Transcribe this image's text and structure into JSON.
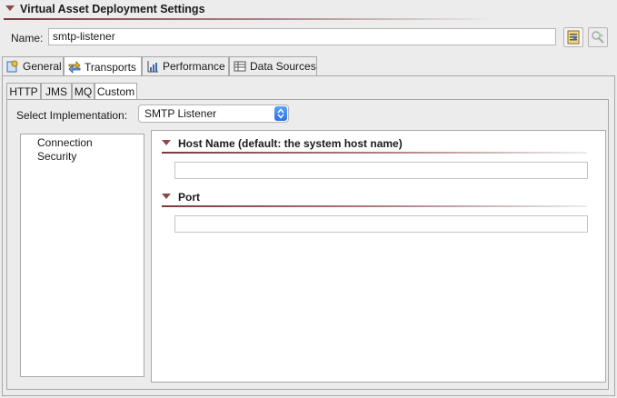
{
  "section": {
    "title": "Virtual Asset Deployment Settings"
  },
  "name_field": {
    "label": "Name:",
    "value": "smtp-listener"
  },
  "toolbar": {
    "btn1_icon": "import-icon",
    "btn2_icon": "find-icon"
  },
  "main_tabs": [
    {
      "label": "General",
      "icon": "general-icon"
    },
    {
      "label": "Transports",
      "icon": "transports-icon"
    },
    {
      "label": "Performance",
      "icon": "performance-icon"
    },
    {
      "label": "Data Sources",
      "icon": "data-sources-icon"
    }
  ],
  "sub_tabs": [
    "HTTP",
    "JMS",
    "MQ",
    "Custom"
  ],
  "implementation": {
    "label": "Select Implementation:",
    "selected": "SMTP Listener"
  },
  "left_list": {
    "items": [
      "Connection",
      "Security"
    ]
  },
  "fields": {
    "host": {
      "title": "Host Name (default: the system host name)",
      "value": ""
    },
    "port": {
      "title": "Port",
      "value": ""
    }
  },
  "colors": {
    "accent": "#7a3b3b",
    "select_blue": "#2c71e6"
  }
}
